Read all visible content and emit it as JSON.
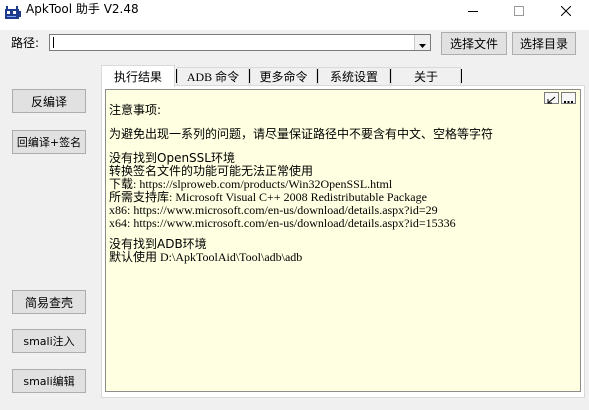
{
  "window": {
    "title": "ApkTool 助手 V2.48",
    "icon": "android-icon",
    "controls": [
      "minimize-icon",
      "maximize-icon",
      "close-icon"
    ]
  },
  "path": {
    "label": "路径:",
    "value": "",
    "placeholder": ""
  },
  "buttons": {
    "select_file": "选择文件",
    "select_dir": "选择目录",
    "decompile": "反编译",
    "recompile_sign": "回编译+签名",
    "easy_view": "简易查壳",
    "smali_inject": "smali注入",
    "smali_edit": "smali编辑"
  },
  "tabs": [
    {
      "label": "执行结果",
      "active": true
    },
    {
      "label": "ADB 命令",
      "active": false
    },
    {
      "label": "更多命令",
      "active": false
    },
    {
      "label": "系统设置",
      "active": false
    },
    {
      "label": "关于",
      "active": false
    }
  ],
  "output": {
    "lines": [
      "注意事项:",
      "为避免出现一系列的问题，请尽量保证路径中不要含有中文、空格等字符",
      "没有找到OpenSSL环境",
      "转换签名文件的功能可能无法正常使用",
      "下载: https://slproweb.com/products/Win32OpenSSL.html",
      "所需支持库: Microsoft Visual C++ 2008 Redistributable Package",
      "x86: https://www.microsoft.com/en-us/download/details.aspx?id=29",
      "x64: https://www.microsoft.com/en-us/download/details.aspx?id=15336",
      "没有找到ADB环境",
      "默认使用 D:\\ApkToolAid\\Tool\\adb\\adb"
    ],
    "tools": [
      "pin-icon",
      "more-icon"
    ]
  }
}
